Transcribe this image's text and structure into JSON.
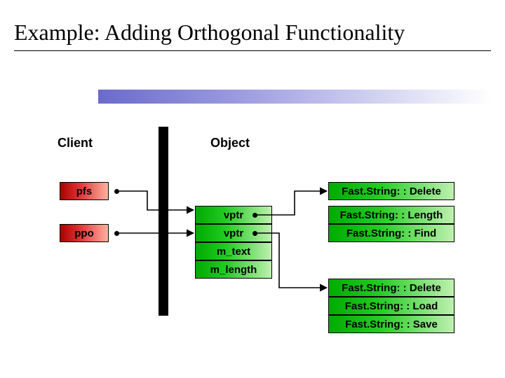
{
  "title": "Example:  Adding Orthogonal Functionality",
  "headings": {
    "client": "Client",
    "object": "Object"
  },
  "client": {
    "pfs": "pfs",
    "ppo": "ppo"
  },
  "object": {
    "vptr1": "vptr",
    "vptr2": "vptr",
    "m_text": "m_text",
    "m_length": "m_length"
  },
  "vtable1": {
    "m0": "Fast.String: : Delete",
    "m1": "Fast.String: : Length",
    "m2": "Fast.String: : Find"
  },
  "vtable2": {
    "m0": "Fast.String: : Delete",
    "m1": "Fast.String: : Load",
    "m2": "Fast.String: : Save"
  }
}
